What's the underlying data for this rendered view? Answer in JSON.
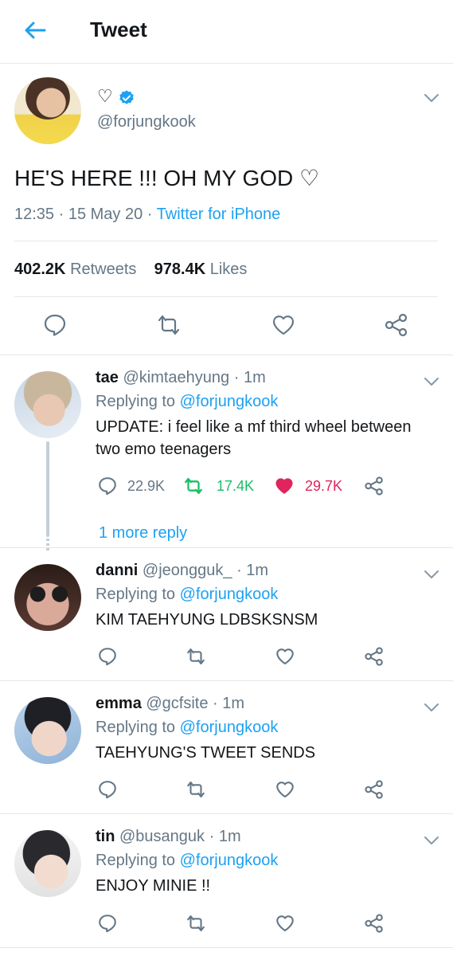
{
  "header": {
    "title": "Tweet",
    "back_icon": "arrow-left-icon"
  },
  "main_tweet": {
    "name": "♡",
    "handle": "@forjungkook",
    "text": "HE'S HERE !!! OH MY GOD ♡",
    "time": "12:35",
    "date": "15 May 20",
    "source": "Twitter for iPhone",
    "retweets_count": "402.2K",
    "retweets_label": "Retweets",
    "likes_count": "978.4K",
    "likes_label": "Likes"
  },
  "replies": [
    {
      "name": "tae",
      "handle": "@kimtaehyung",
      "time": "1m",
      "replying_label": "Replying to",
      "replying_to": "@forjungkook",
      "text": "UPDATE: i feel like a mf third wheel between two emo teenagers",
      "reply_count": "22.9K",
      "retweet_count": "17.4K",
      "like_count": "29.7K",
      "liked": true,
      "retweeted": true,
      "more_reply": "1 more reply"
    },
    {
      "name": "danni",
      "handle": "@jeongguk_",
      "time": "1m",
      "replying_label": "Replying to",
      "replying_to": "@forjungkook",
      "text": "KIM TAEHYUNG LDBSKSNSM"
    },
    {
      "name": "emma",
      "handle": "@gcfsite",
      "time": "1m",
      "replying_label": "Replying to",
      "replying_to": "@forjungkook",
      "text": "TAEHYUNG'S TWEET SENDS"
    },
    {
      "name": "tin",
      "handle": "@busanguk",
      "time": "1m",
      "replying_label": "Replying to",
      "replying_to": "@forjungkook",
      "text": "ENJOY MINIE !!"
    }
  ],
  "colors": {
    "accent": "#1da1f2",
    "retweet_active": "#17bf63",
    "like_active": "#e0245e",
    "secondary_text": "#657786",
    "divider": "#e1e8ed"
  }
}
